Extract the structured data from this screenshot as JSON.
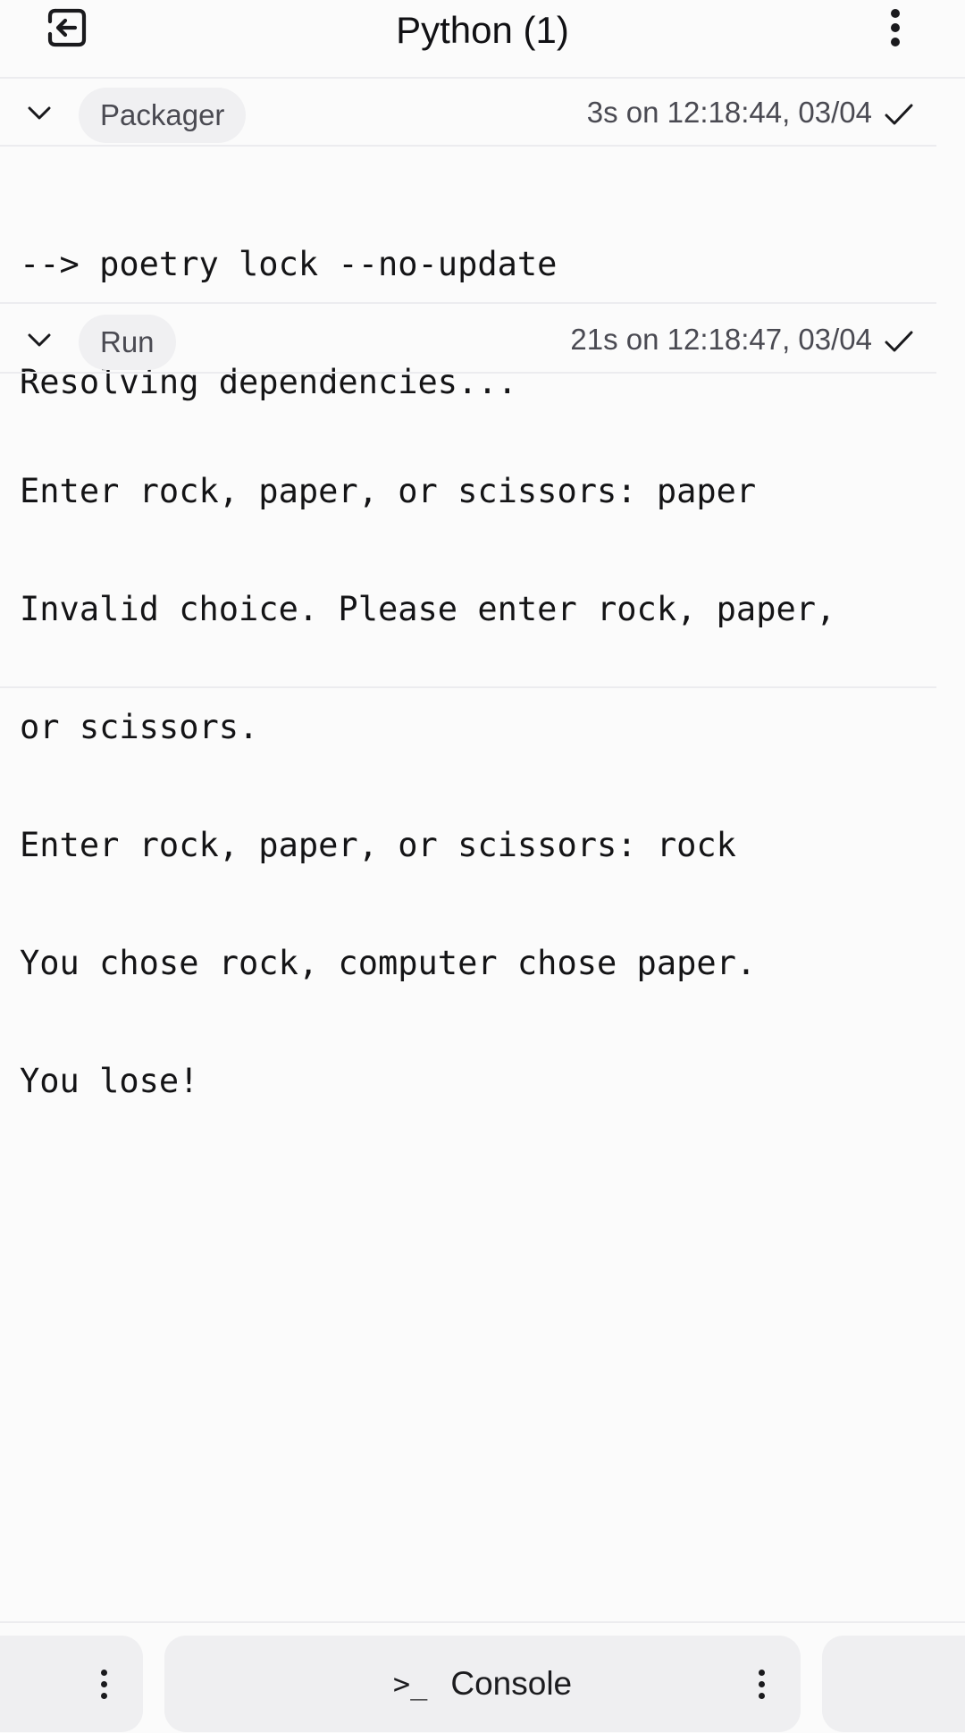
{
  "header": {
    "title": "Python (1)",
    "back_icon": "exit-arrow-icon",
    "menu_icon": "more-vertical-icon"
  },
  "sections": [
    {
      "name": "Packager",
      "meta": "3s on 12:18:44, 03/04",
      "status_icon": "check-icon",
      "lines": [
        "--> poetry lock --no-update",
        "Resolving dependencies..."
      ]
    },
    {
      "name": "Run",
      "meta": "21s on 12:18:47, 03/04",
      "status_icon": "check-icon",
      "lines": [
        "Enter rock, paper, or scissors: paper",
        "Invalid choice. Please enter rock, paper,",
        "or scissors.",
        "Enter rock, paper, or scissors: rock",
        "You chose rock, computer chose paper.",
        "You lose!"
      ]
    }
  ],
  "bottom_bar": {
    "console_label": "Console",
    "console_icon": ">_"
  }
}
